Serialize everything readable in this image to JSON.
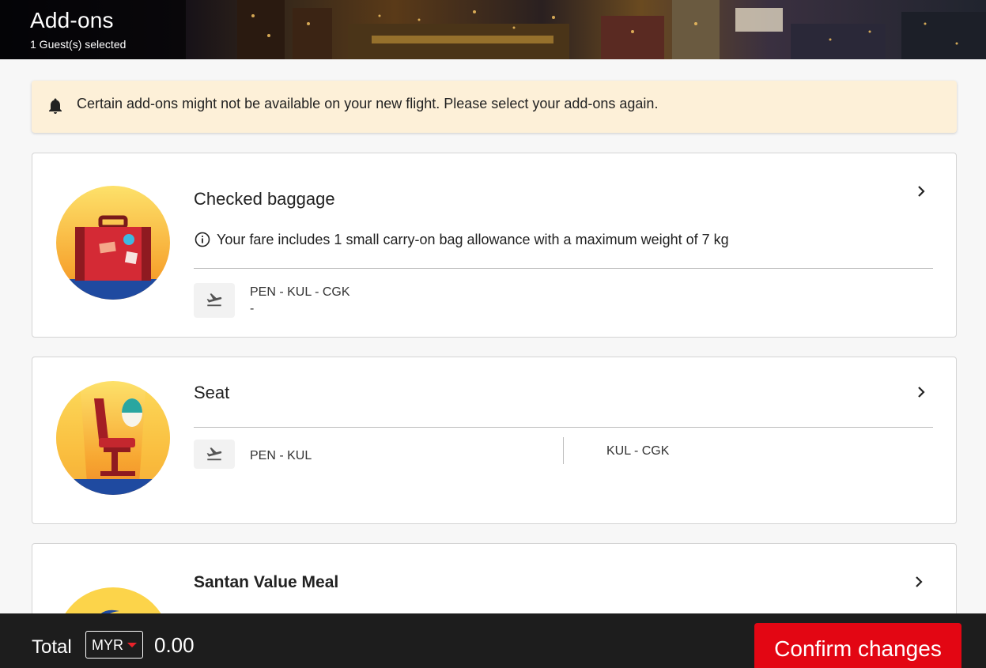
{
  "header": {
    "title": "Add-ons",
    "subtitle": "1 Guest(s) selected"
  },
  "notice": {
    "icon": "bell-icon",
    "text": "Certain add-ons might not be available on your new flight. Please select your add-ons again."
  },
  "baggage": {
    "title": "Checked baggage",
    "info_icon": "info-icon",
    "info": "Your fare includes 1 small carry-on bag allowance with a maximum weight of 7 kg",
    "routes": [
      {
        "route": "PEN - KUL - CGK",
        "value": "-"
      }
    ]
  },
  "seat": {
    "title": "Seat",
    "routes": [
      {
        "route": "PEN - KUL"
      },
      {
        "route": "KUL - CGK"
      }
    ]
  },
  "meal": {
    "title": "Santan Value Meal"
  },
  "footer": {
    "total_label": "Total",
    "currency": "MYR",
    "amount": "0.00",
    "confirm_label": "Confirm changes"
  },
  "colors": {
    "brand_red": "#e30613",
    "notice_bg": "#fdf0d8",
    "footer_bg": "#1d1d1d"
  }
}
